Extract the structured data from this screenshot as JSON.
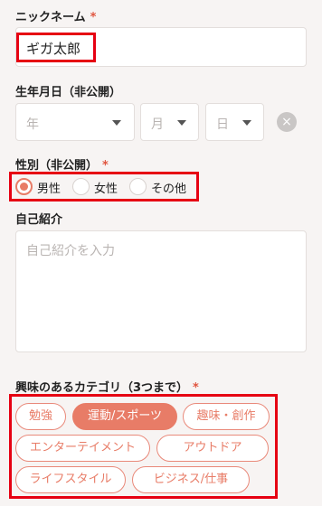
{
  "nickname": {
    "label": "ニックネーム",
    "required_mark": "*",
    "value": "ギガ太郎"
  },
  "birthday": {
    "label": "生年月日（非公開）",
    "year_placeholder": "年",
    "month_placeholder": "月",
    "day_placeholder": "日",
    "clear_icon": "×"
  },
  "gender": {
    "label": "性別（非公開）",
    "required_mark": "*",
    "options": [
      {
        "label": "男性",
        "selected": true
      },
      {
        "label": "女性",
        "selected": false
      },
      {
        "label": "その他",
        "selected": false
      }
    ]
  },
  "intro": {
    "label": "自己紹介",
    "placeholder": "自己紹介を入力"
  },
  "interests": {
    "label": "興味のあるカテゴリ（3つまで）",
    "required_mark": "*",
    "chips": [
      {
        "label": "勉強",
        "selected": false
      },
      {
        "label": "運動/スポーツ",
        "selected": true
      },
      {
        "label": "趣味・創作",
        "selected": false
      },
      {
        "label": "エンターテイメント",
        "selected": false
      },
      {
        "label": "アウトドア",
        "selected": false
      },
      {
        "label": "ライフスタイル",
        "selected": false
      },
      {
        "label": "ビジネス/仕事",
        "selected": false
      }
    ]
  },
  "colors": {
    "accent": "#e87c67",
    "highlight": "#e60012"
  }
}
